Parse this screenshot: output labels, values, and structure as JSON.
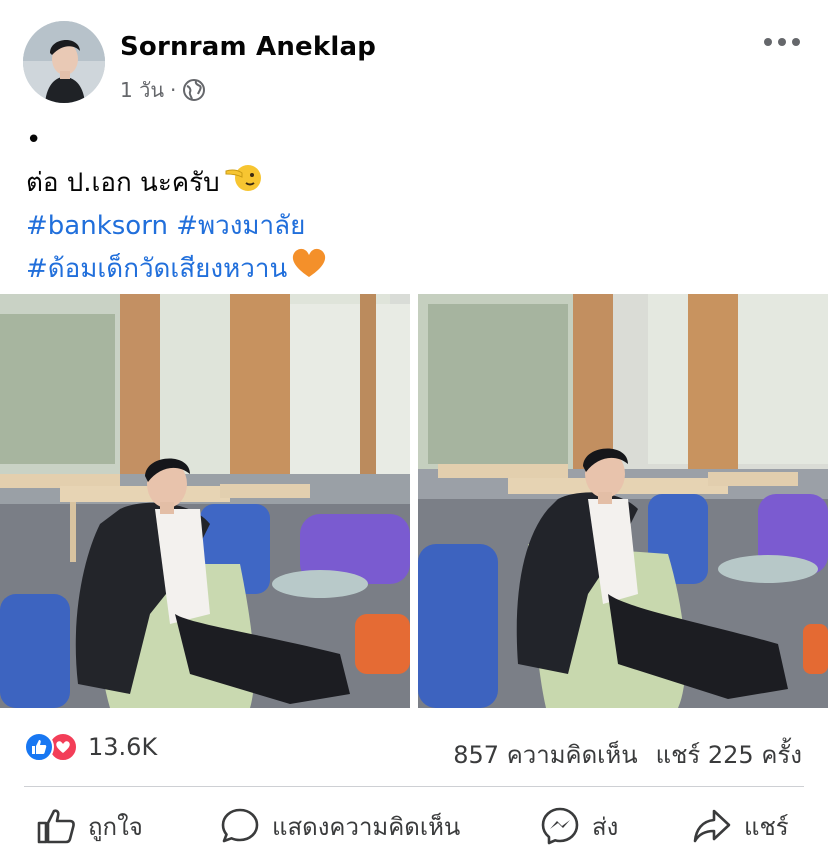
{
  "post": {
    "author": "Sornram Aneklap",
    "time": "1 วัน",
    "separator": "·",
    "audience_icon": "globe-icon",
    "more_icon": "more-options-icon"
  },
  "caption": {
    "line1": "•",
    "line2": "ต่อ ป.เอก นะครับ",
    "line2_emoji": "pointing-face-emoji",
    "line3_tag1": "#banksorn",
    "line3_tag2": "#พวงมาลัย",
    "line4_tag": "#ด้อมเด็กวัดเสียงหวาน",
    "line4_emoji": "orange-heart-emoji"
  },
  "photos": [
    {
      "icon": "photo-man-in-suit-library-1"
    },
    {
      "icon": "photo-man-in-suit-library-2"
    }
  ],
  "stats": {
    "reaction_count": "13.6K",
    "comments": "857 ความคิดเห็น",
    "shares": "แชร์ 225 ครั้ง"
  },
  "actions": {
    "like": "ถูกใจ",
    "comment": "แสดงความคิดเห็น",
    "send": "ส่ง",
    "share": "แชร์"
  },
  "colors": {
    "hashtag": "#216fdb",
    "like_blue": "#1877f2",
    "love_red": "#f33e58",
    "secondary_text": "#65676b"
  }
}
